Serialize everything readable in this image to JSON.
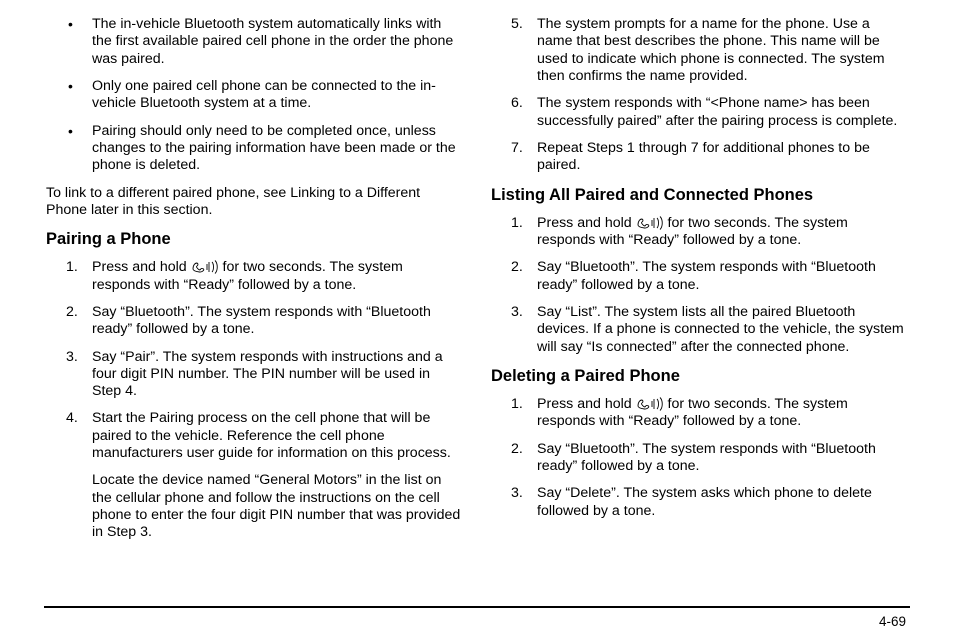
{
  "left": {
    "bullets": [
      "The in-vehicle Bluetooth system automatically links with the first available paired cell phone in the order the phone was paired.",
      "Only one paired cell phone can be connected to the in-vehicle Bluetooth system at a time.",
      "Pairing should only need to be completed once, unless changes to the pairing information have been made or the phone is deleted."
    ],
    "link_para": "To link to a different paired phone, see Linking to a Different Phone later in this section.",
    "pairing_heading": "Pairing a Phone",
    "pairing_steps": {
      "s1a": "Press and hold ",
      "s1b": " for two seconds. The system responds with “Ready” followed by a tone.",
      "s2": "Say “Bluetooth”. The system responds with “Bluetooth ready” followed by a tone.",
      "s3": "Say “Pair”. The system responds with instructions and a four digit PIN number. The PIN number will be used in Step 4.",
      "s4": "Start the Pairing process on the cell phone that will be paired to the vehicle. Reference the cell phone manufacturers user guide for information on this process.",
      "s4_sub": "Locate the device named “General Motors” in the list on the cellular phone and follow the instructions on the cell phone to enter the four digit PIN number that was provided in Step 3."
    }
  },
  "right": {
    "pairing_steps_cont": {
      "s5": "The system prompts for a name for the phone. Use a name that best describes the phone. This name will be used to indicate which phone is connected. The system then confirms the name provided.",
      "s6": "The system responds with “<Phone name> has been successfully paired” after the pairing process is complete.",
      "s7": "Repeat Steps 1 through 7 for additional phones to be paired."
    },
    "listing_heading": "Listing All Paired and Connected Phones",
    "listing_steps": {
      "s1a": "Press and hold ",
      "s1b": " for two seconds. The system responds with “Ready” followed by a tone.",
      "s2": "Say “Bluetooth”. The system responds with “Bluetooth ready” followed by a tone.",
      "s3": "Say “List”. The system lists all the paired Bluetooth devices. If a phone is connected to the vehicle, the system will say “Is connected” after the connected phone."
    },
    "deleting_heading": "Deleting a Paired Phone",
    "deleting_steps": {
      "s1a": "Press and hold ",
      "s1b": " for two seconds. The system responds with “Ready” followed by a tone.",
      "s2": "Say “Bluetooth”. The system responds with “Bluetooth ready” followed by a tone.",
      "s3": "Say “Delete”. The system asks which phone to delete followed by a tone."
    }
  },
  "page_number": "4-69"
}
